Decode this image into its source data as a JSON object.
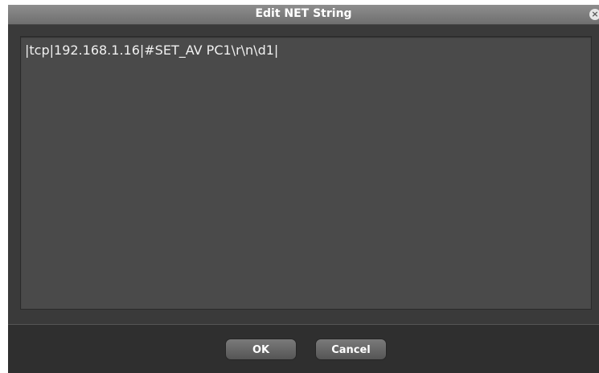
{
  "dialog": {
    "title": "Edit NET String",
    "close_icon": "close-icon"
  },
  "editor": {
    "value": "|tcp|192.168.1.16|#SET_AV PC1\\r\\n\\d1|"
  },
  "buttons": {
    "ok_label": "OK",
    "cancel_label": "Cancel"
  }
}
